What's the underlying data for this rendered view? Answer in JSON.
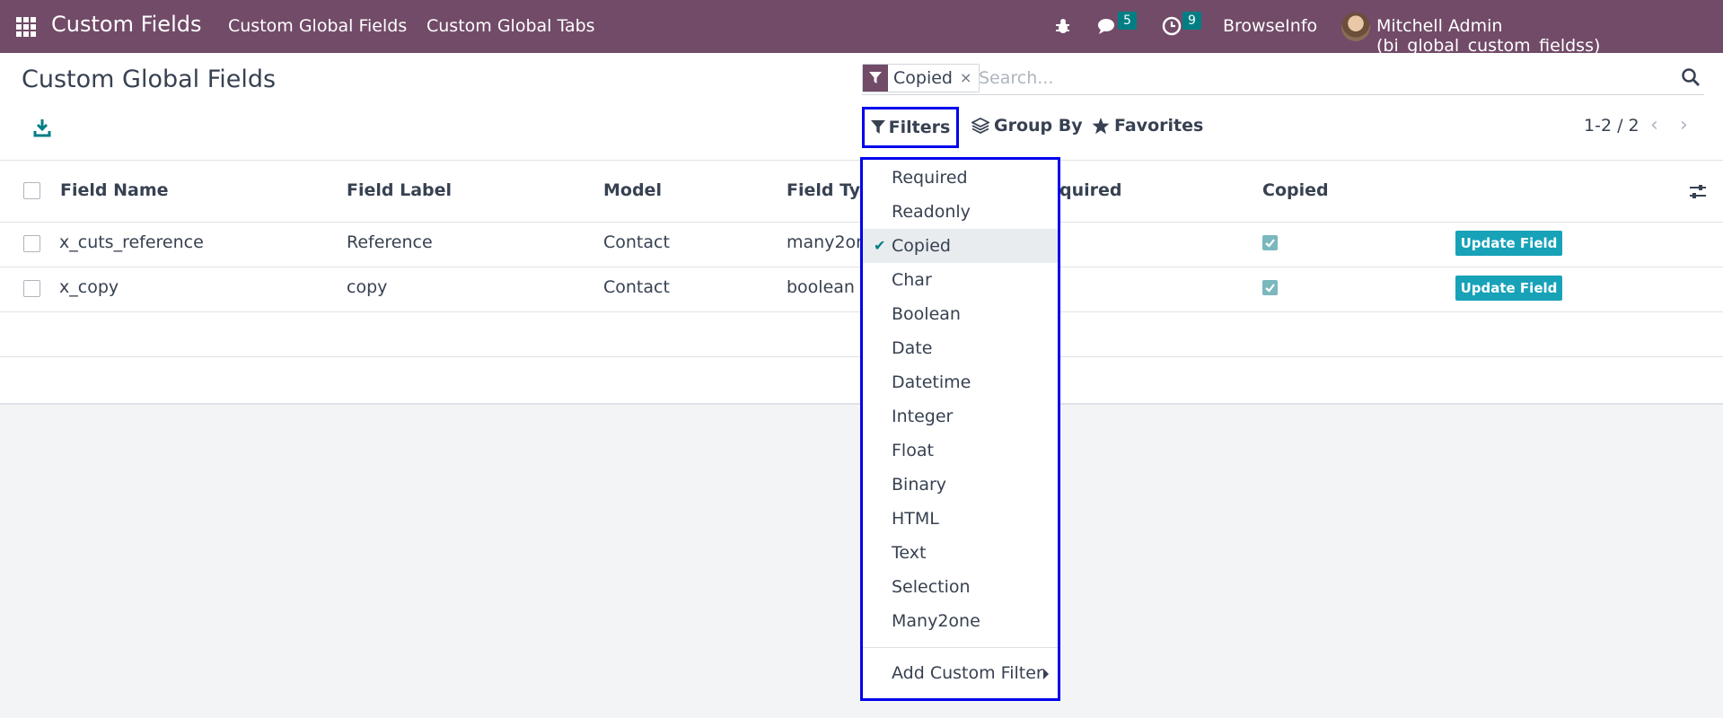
{
  "navbar": {
    "app_title": "Custom Fields",
    "menu": [
      "Custom Global Fields",
      "Custom Global Tabs"
    ],
    "messages_count": "5",
    "activities_count": "9",
    "company": "BrowseInfo",
    "user": "Mitchell Admin (bi_global_custom_fieldss)"
  },
  "panel": {
    "title": "Custom Global Fields",
    "facet_label": "Copied",
    "facet_remove": "×",
    "search_placeholder": "Search...",
    "filters_label": "Filters",
    "groupby_label": "Group By",
    "favorites_label": "Favorites",
    "pager": "1-2 / 2"
  },
  "list": {
    "columns": [
      "Field Name",
      "Field Label",
      "Model",
      "Field Typ",
      "quired",
      "Copied"
    ],
    "rows": [
      {
        "field_name": "x_cuts_reference",
        "field_label": "Reference",
        "model": "Contact",
        "field_type": "many2on",
        "copied": true,
        "action": "Update Field"
      },
      {
        "field_name": "x_copy",
        "field_label": "copy",
        "model": "Contact",
        "field_type": "boolean",
        "copied": true,
        "action": "Update Field"
      }
    ]
  },
  "filters_dropdown": {
    "items": [
      "Required",
      "Readonly",
      "Copied",
      "Char",
      "Boolean",
      "Date",
      "Datetime",
      "Integer",
      "Float",
      "Binary",
      "HTML",
      "Text",
      "Selection",
      "Many2one"
    ],
    "active": "Copied",
    "add_custom": "Add Custom Filter"
  },
  "colors": {
    "navbar": "#714b67",
    "accent_teal": "#017e84",
    "update_button": "#17a2b8",
    "highlight_border": "#0000ee"
  }
}
